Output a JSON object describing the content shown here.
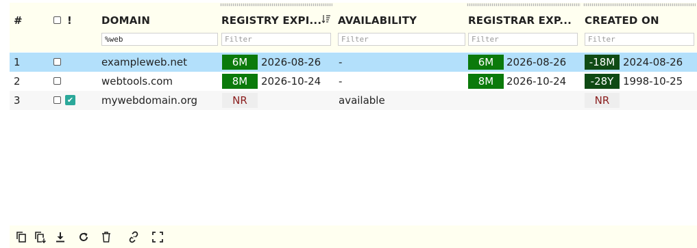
{
  "header": {
    "num": "#",
    "flag": "!",
    "domain": "DOMAIN",
    "registry_expiry": "REGISTRY EXPI...",
    "availability": "AVAILABILITY",
    "registrar_expiry": "REGISTRAR EXP...",
    "created_on": "CREATED ON"
  },
  "filters": {
    "domain_value": "%web",
    "placeholder": "Filter"
  },
  "rows": [
    {
      "num": "1",
      "domain": "exampleweb.net",
      "registry_badge": "6M",
      "registry_date": "2026-08-26",
      "availability": "-",
      "registrar_badge": "6M",
      "registrar_date": "2026-08-26",
      "created_badge": "-18M",
      "created_date": "2024-08-26",
      "selected": true,
      "flagged": false
    },
    {
      "num": "2",
      "domain": "webtools.com",
      "registry_badge": "8M",
      "registry_date": "2026-10-24",
      "availability": "-",
      "registrar_badge": "8M",
      "registrar_date": "2026-10-24",
      "created_badge": "-28Y",
      "created_date": "1998-10-25",
      "selected": false,
      "flagged": false
    },
    {
      "num": "3",
      "domain": "mywebdomain.org",
      "registry_badge": "NR",
      "registry_date": "",
      "availability": "available",
      "registrar_badge": "",
      "registrar_date": "",
      "created_badge": "NR",
      "created_date": "",
      "selected": false,
      "flagged": true
    }
  ],
  "toolbar": [
    "copy-icon",
    "copy-selected-icon",
    "download-icon",
    "refresh-icon",
    "delete-icon",
    "link-icon",
    "fullscreen-icon"
  ],
  "colors": {
    "selected_row": "#b3e0fb",
    "badge_green": "#0b7a0b",
    "badge_dark_green": "#0f4a14",
    "nr_text": "#8a1c1c",
    "header_bg": "#fffff0",
    "flag_teal": "#2ba89a"
  }
}
